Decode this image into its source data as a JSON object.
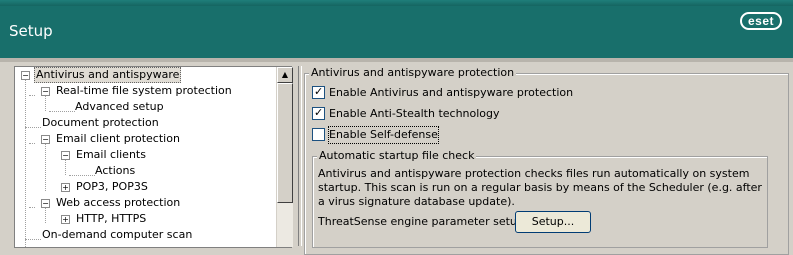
{
  "header": {
    "title": "Setup",
    "logo_text": "eset"
  },
  "tree": {
    "items": [
      {
        "label": "Antivirus and antispyware",
        "toggle": "−",
        "selected": true
      },
      {
        "label": "Real-time file system protection",
        "toggle": "−"
      },
      {
        "label": "Advanced setup",
        "toggle": ""
      },
      {
        "label": "Document protection",
        "toggle": ""
      },
      {
        "label": "Email client protection",
        "toggle": "−"
      },
      {
        "label": "Email clients",
        "toggle": "−"
      },
      {
        "label": "Actions",
        "toggle": ""
      },
      {
        "label": "POP3, POP3S",
        "toggle": "+"
      },
      {
        "label": "Web access protection",
        "toggle": "−"
      },
      {
        "label": "HTTP, HTTPS",
        "toggle": "+"
      },
      {
        "label": "On-demand computer scan",
        "toggle": ""
      }
    ]
  },
  "main": {
    "group_title": "Antivirus and antispyware protection",
    "options": [
      {
        "label": "Enable Antivirus and antispyware protection",
        "checked": true
      },
      {
        "label": "Enable Anti-Stealth technology",
        "checked": true
      },
      {
        "label": "Enable Self-defense",
        "checked": false
      }
    ],
    "startup": {
      "title": "Automatic startup file check",
      "description": "Antivirus and antispyware protection checks files run automatically on system startup. This scan is run on a regular basis by means of the Scheduler (e.g. after a virus signature database update).",
      "threatsense_label": "ThreatSense engine parameter setup:",
      "setup_button_label": "Setup..."
    }
  },
  "colors": {
    "header_bg": "#186f6b",
    "window_bg": "#d4d0c8"
  }
}
